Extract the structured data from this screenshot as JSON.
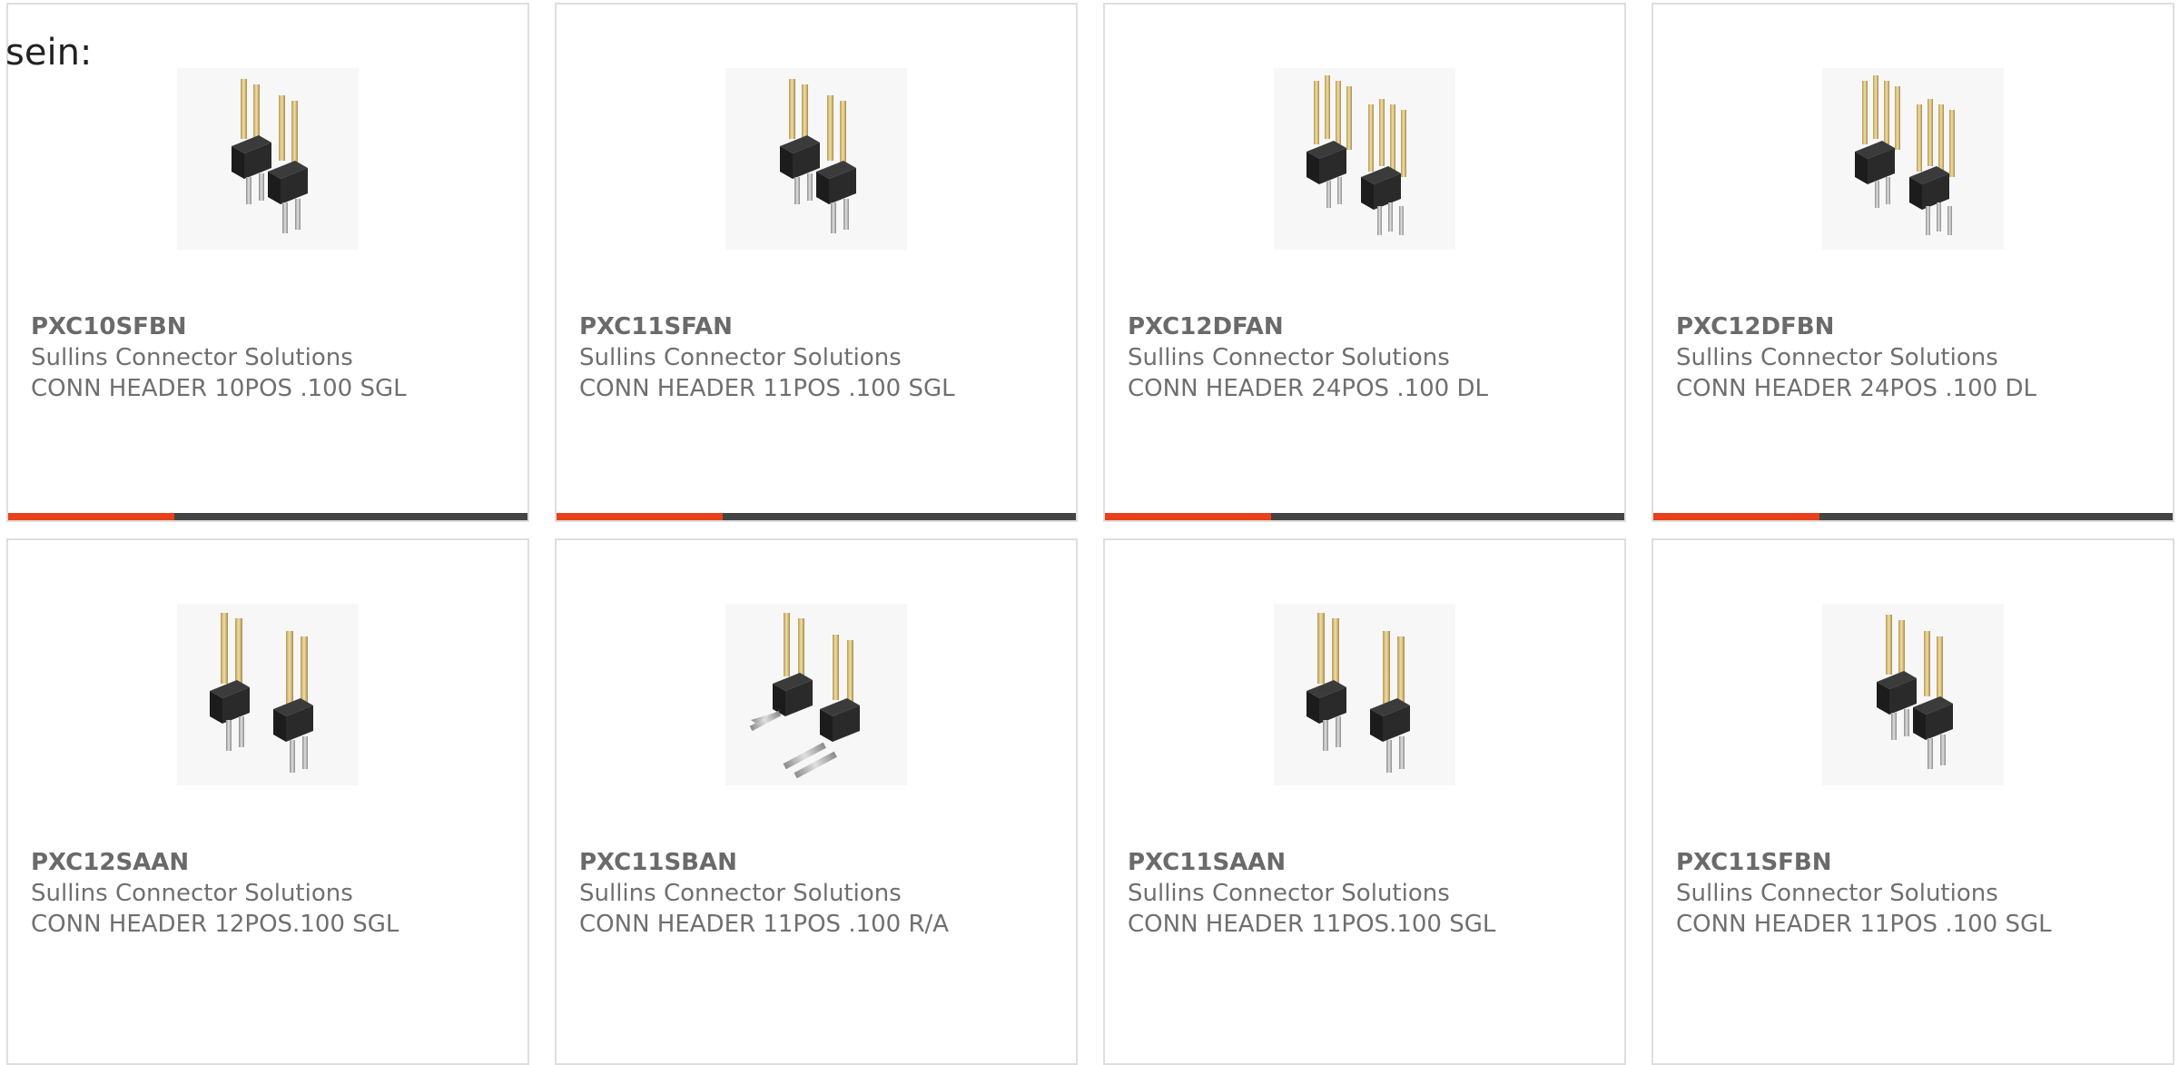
{
  "intro_text": "sein:",
  "colors": {
    "accent": "#e8401a",
    "track": "#444444",
    "border": "#dedede",
    "text": "#6a6a6a"
  },
  "products": [
    {
      "part": "PXC10SFBN",
      "maker": "Sullins Connector Solutions",
      "desc": "CONN HEADER 10POS .100 SGL",
      "icon": "single-row-pin-header-image",
      "progress": 0.32
    },
    {
      "part": "PXC11SFAN",
      "maker": "Sullins Connector Solutions",
      "desc": "CONN HEADER 11POS .100 SGL",
      "icon": "single-row-pin-header-image",
      "progress": 0.32
    },
    {
      "part": "PXC12DFAN",
      "maker": "Sullins Connector Solutions",
      "desc": "CONN HEADER 24POS .100 DL",
      "icon": "dual-row-pin-header-image",
      "progress": 0.32
    },
    {
      "part": "PXC12DFBN",
      "maker": "Sullins Connector Solutions",
      "desc": "CONN HEADER 24POS .100 DL",
      "icon": "dual-row-pin-header-image",
      "progress": 0.32
    },
    {
      "part": "PXC12SAAN",
      "maker": "Sullins Connector Solutions",
      "desc": "CONN HEADER 12POS.100 SGL",
      "icon": "single-row-pin-header-image"
    },
    {
      "part": "PXC11SBAN",
      "maker": "Sullins Connector Solutions",
      "desc": "CONN HEADER 11POS .100 R/A",
      "icon": "right-angle-pin-header-image"
    },
    {
      "part": "PXC11SAAN",
      "maker": "Sullins Connector Solutions",
      "desc": "CONN HEADER 11POS.100 SGL",
      "icon": "single-row-pin-header-image"
    },
    {
      "part": "PXC11SFBN",
      "maker": "Sullins Connector Solutions",
      "desc": "CONN HEADER 11POS .100 SGL",
      "icon": "single-row-pin-header-image"
    }
  ]
}
